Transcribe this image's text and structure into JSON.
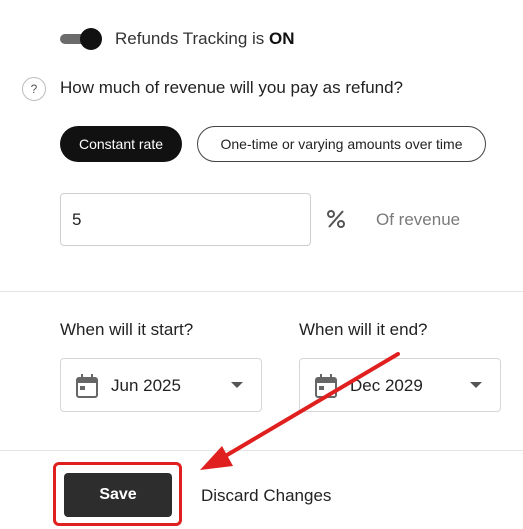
{
  "refunds_toggle": {
    "label_prefix": "Refunds Tracking is ",
    "state": "ON"
  },
  "question": {
    "help_glyph": "?",
    "text": "How much of revenue will you pay as refund?"
  },
  "rate_options": {
    "constant": "Constant rate",
    "varying": "One-time or varying amounts over time",
    "selected": "constant"
  },
  "rate_input": {
    "value": "5",
    "unit_icon": "percent-icon",
    "suffix": "Of revenue"
  },
  "start": {
    "label": "When will it start?",
    "value": "Jun 2025",
    "icon": "calendar-icon"
  },
  "end": {
    "label": "When will it end?",
    "value": "Dec 2029",
    "icon": "calendar-icon"
  },
  "actions": {
    "save": "Save",
    "discard": "Discard Changes"
  },
  "colors": {
    "highlight": "#e0201e",
    "primary_button": "#2d2d2d",
    "selected_pill": "#111111"
  }
}
